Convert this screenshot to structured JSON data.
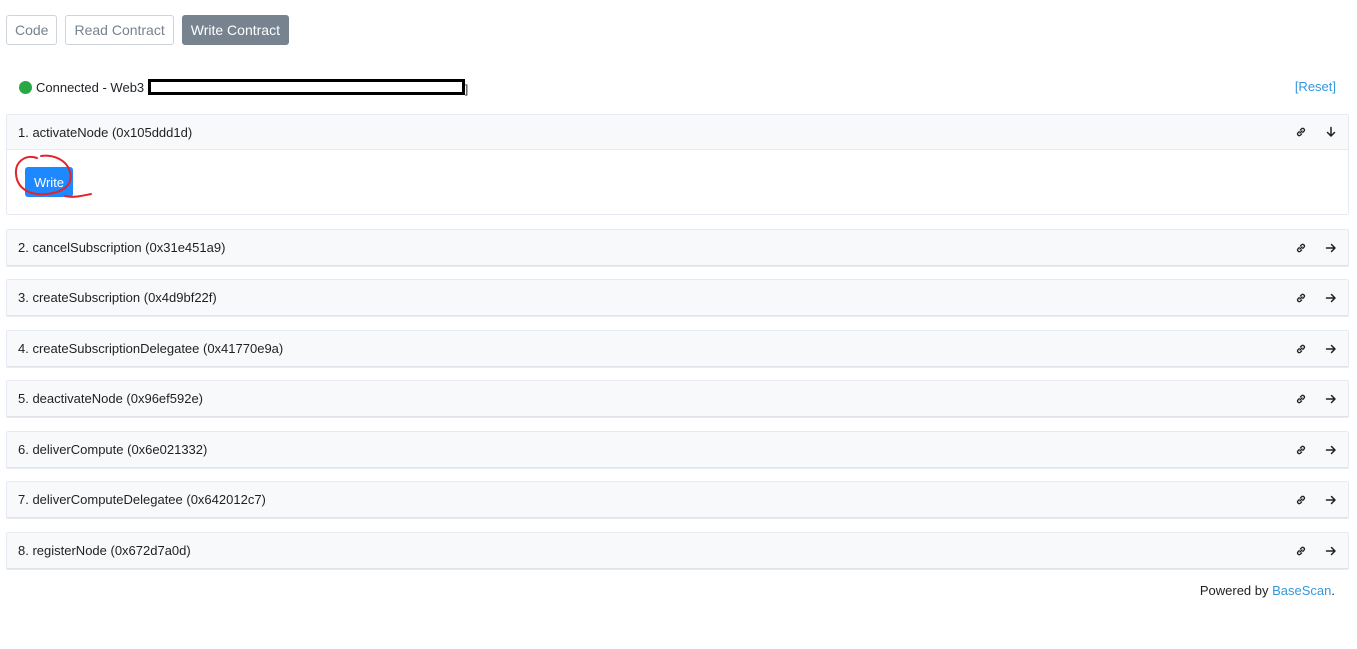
{
  "tabs": [
    {
      "label": "Code",
      "active": false
    },
    {
      "label": "Read Contract",
      "active": false
    },
    {
      "label": "Write Contract",
      "active": true
    }
  ],
  "connection": {
    "status_text": "Connected - Web3",
    "bracket": "]",
    "status_color": "#28a745"
  },
  "reset_label": "[Reset]",
  "functions": [
    {
      "label": "1. activateNode (0x105ddd1d)",
      "expanded": true
    },
    {
      "label": "2. cancelSubscription (0x31e451a9)",
      "expanded": false
    },
    {
      "label": "3. createSubscription (0x4d9bf22f)",
      "expanded": false
    },
    {
      "label": "4. createSubscriptionDelegatee (0x41770e9a)",
      "expanded": false
    },
    {
      "label": "5. deactivateNode (0x96ef592e)",
      "expanded": false
    },
    {
      "label": "6. deliverCompute (0x6e021332)",
      "expanded": false
    },
    {
      "label": "7. deliverComputeDelegatee (0x642012c7)",
      "expanded": false
    },
    {
      "label": "8. registerNode (0x672d7a0d)",
      "expanded": false
    }
  ],
  "write_label": "Write",
  "footer": {
    "prefix": "Powered by ",
    "link": "BaseScan",
    "suffix": "."
  },
  "icons": {
    "link": "link-icon",
    "expanded": "arrow-down-icon",
    "collapsed": "arrow-right-icon"
  },
  "colors": {
    "accent": "#1e88ff",
    "link": "#3498db",
    "annotation": "#e3232b"
  }
}
